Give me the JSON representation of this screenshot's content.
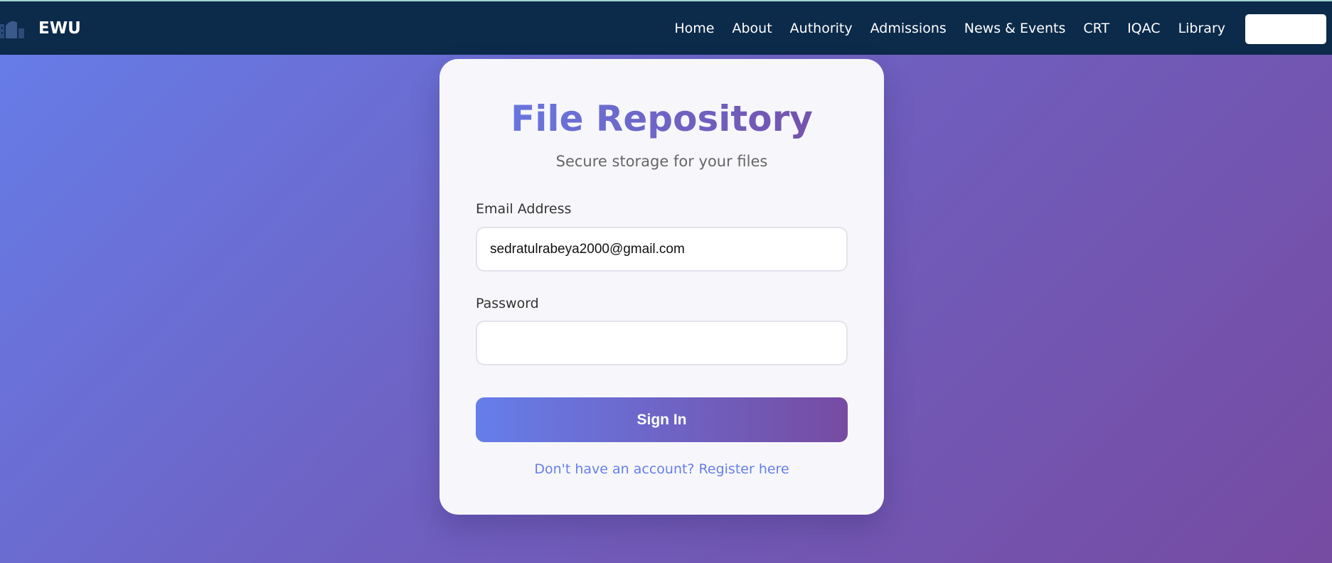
{
  "colors": {
    "navbar_bg": "#0c2a4a",
    "gradient_start": "#667eea",
    "gradient_end": "#764ba2",
    "card_bg": "#f7f7fb",
    "link": "#667eea"
  },
  "navbar": {
    "logo_icon": "university-building-icon",
    "brand": "EWU",
    "links": [
      "Home",
      "About",
      "Authority",
      "Admissions",
      "News & Events",
      "CRT",
      "IQAC",
      "Library"
    ],
    "button_label": ""
  },
  "login": {
    "title": "File Repository",
    "subtitle": "Secure storage for your files",
    "email_label": "Email Address",
    "email_value": "sedratulrabeya2000@gmail.com",
    "password_label": "Password",
    "password_value": "",
    "submit_label": "Sign In",
    "register_text": "Don't have an account? Register here"
  }
}
